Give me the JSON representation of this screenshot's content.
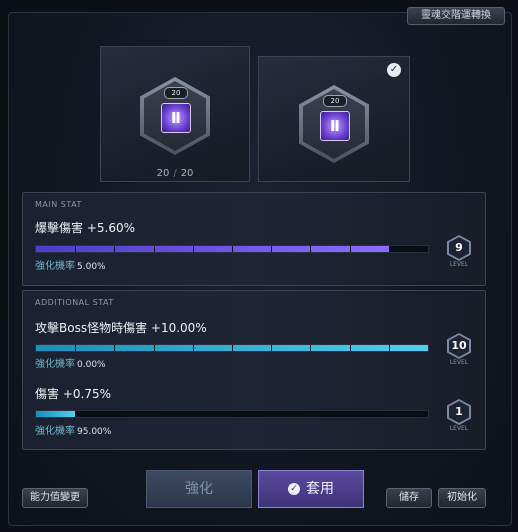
{
  "header": {
    "top_button_label": "靈魂交階運轉換"
  },
  "cards": {
    "left": {
      "gem_glyph": "Ⅱ",
      "badge": "20",
      "count_current": "20",
      "count_sep": "/",
      "count_max": "20"
    },
    "right": {
      "gem_glyph": "Ⅱ",
      "badge": "20",
      "selected_icon": "check-icon"
    }
  },
  "main_stat": {
    "label": "MAIN STAT",
    "name": "爆擊傷害 +5.60%",
    "rate_label": "強化機率",
    "rate_value": "5.00%",
    "level": "9",
    "level_label": "LEVEL",
    "progress": 0.9,
    "color": "#8d6bff"
  },
  "additional_stat": {
    "label": "ADDITIONAL STAT",
    "stats": [
      {
        "name": "攻擊Boss怪物時傷害 +10.00%",
        "rate_label": "強化機率",
        "rate_value": "0.00%",
        "level": "10",
        "level_label": "LEVEL",
        "progress": 1.0,
        "color": "#4fd0f0"
      },
      {
        "name": "傷害 +0.75%",
        "rate_label": "強化機率",
        "rate_value": "95.00%",
        "level": "1",
        "level_label": "LEVEL",
        "progress": 0.1,
        "color": "#4fd0f0"
      }
    ]
  },
  "buttons": {
    "change_stats": "能力值變更",
    "enhance": "強化",
    "apply": "套用",
    "save": "儲存",
    "reset": "初始化"
  }
}
